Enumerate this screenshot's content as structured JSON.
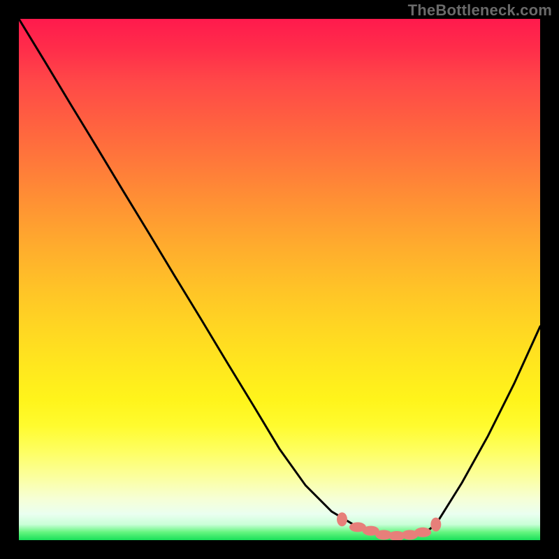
{
  "watermark": "TheBottleneck.com",
  "colors": {
    "frame": "#000000",
    "curve_stroke": "#000000",
    "marker_fill": "#e77f7a",
    "marker_stroke": "#c85a55",
    "watermark_text": "#6a6a6a"
  },
  "chart_data": {
    "type": "line",
    "title": "",
    "xlabel": "",
    "ylabel": "",
    "xlim": [
      0,
      100
    ],
    "ylim": [
      0,
      100
    ],
    "x": [
      0,
      5,
      10,
      15,
      20,
      25,
      30,
      35,
      40,
      45,
      50,
      55,
      60,
      65,
      68,
      70,
      72,
      74,
      76,
      78,
      80,
      85,
      90,
      95,
      100
    ],
    "values": [
      100,
      91.8,
      83.5,
      75.3,
      67.0,
      58.8,
      50.5,
      42.3,
      34.0,
      25.8,
      17.5,
      10.5,
      5.5,
      2.5,
      1.5,
      1.0,
      0.8,
      0.8,
      1.0,
      1.5,
      3.0,
      11.0,
      20.0,
      30.0,
      41.0
    ],
    "markers": {
      "x": [
        62,
        65,
        67.5,
        70,
        72.5,
        75,
        77.5,
        80
      ],
      "y": [
        4.0,
        2.5,
        1.8,
        1.0,
        0.8,
        1.0,
        1.5,
        3.0
      ]
    },
    "annotations": []
  }
}
